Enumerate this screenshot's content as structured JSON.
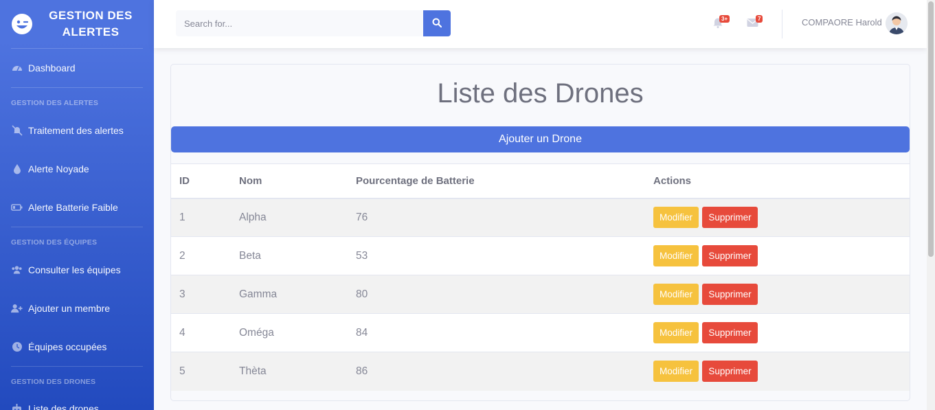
{
  "brand": {
    "title": "GESTION DES ALERTES"
  },
  "sidebar": {
    "dashboard": "Dashboard",
    "sections": [
      {
        "heading": "GESTION DES ALERTES",
        "items": [
          "Traitement des alertes",
          "Alerte Noyade",
          "Alerte Batterie Faible"
        ]
      },
      {
        "heading": "GESTION DES ÉQUIPES",
        "items": [
          "Consulter les équipes",
          "Ajouter un membre",
          "Équipes occupées"
        ]
      },
      {
        "heading": "GESTION DES DRONES",
        "items": [
          "Liste des drones"
        ]
      }
    ]
  },
  "topbar": {
    "search_placeholder": "Search for...",
    "alerts_badge": "3+",
    "messages_badge": "7",
    "user_name": "COMPAORE Harold"
  },
  "page": {
    "title": "Liste des Drones",
    "add_button": "Ajouter un Drone"
  },
  "table": {
    "headers": [
      "ID",
      "Nom",
      "Pourcentage de Batterie",
      "Actions"
    ],
    "rows": [
      {
        "id": "1",
        "nom": "Alpha",
        "batterie": "76"
      },
      {
        "id": "2",
        "nom": "Beta",
        "batterie": "53"
      },
      {
        "id": "3",
        "nom": "Gamma",
        "batterie": "80"
      },
      {
        "id": "4",
        "nom": "Oméga",
        "batterie": "84"
      },
      {
        "id": "5",
        "nom": "Thèta",
        "batterie": "86"
      }
    ],
    "edit_label": "Modifier",
    "delete_label": "Supprimer"
  },
  "colors": {
    "primary": "#4e73df",
    "warning": "#f6c23e",
    "danger": "#e74a3b"
  }
}
